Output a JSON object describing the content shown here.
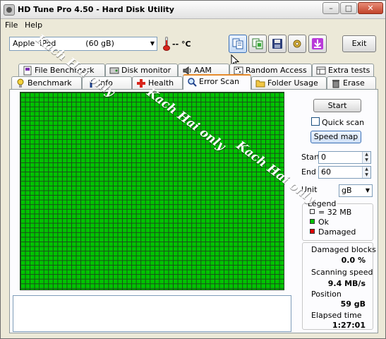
{
  "window": {
    "title": "HD Tune Pro 4.50 - Hard Disk Utility",
    "controls": {
      "minimize": "–",
      "maximize": "□",
      "close": "✕"
    }
  },
  "menu": {
    "file": "File",
    "help": "Help"
  },
  "drive": {
    "selected": "Apple  iPod            (60 gB)",
    "temperature": "-- °C"
  },
  "toolbar": {
    "exit_label": "Exit",
    "icons": [
      "copy-text-icon",
      "copy-image-icon",
      "save-icon",
      "options-icon",
      "download-icon"
    ]
  },
  "tabs_top": [
    "File Benchmark",
    "Disk monitor",
    "AAM",
    "Random Access",
    "Extra tests"
  ],
  "tabs_bottom": [
    "Benchmark",
    "Info",
    "Health",
    "Error Scan",
    "Folder Usage",
    "Erase"
  ],
  "active_tab": "Error Scan",
  "scan": {
    "start_label": "Start",
    "quick_scan_label": "Quick scan",
    "quick_scan_checked": false,
    "speed_map_label": "Speed map",
    "start_field_label": "Start",
    "start_value": "0",
    "end_field_label": "End",
    "end_value": "60",
    "unit_label": "Unit",
    "unit_value": "gB"
  },
  "legend": {
    "title": "Legend",
    "block_size": "= 32 MB",
    "ok_label": "Ok",
    "damaged_label": "Damaged",
    "ok_color": "#00c400",
    "damaged_color": "#e00000"
  },
  "stats": {
    "damaged_blocks_label": "Damaged blocks",
    "damaged_blocks_value": "0.0 %",
    "scanning_speed_label": "Scanning speed",
    "scanning_speed_value": "9.4 MB/s",
    "position_label": "Position",
    "position_value": "59 gB",
    "elapsed_label": "Elapsed time",
    "elapsed_value": "1:27:01"
  },
  "watermark": "Kach Hai only"
}
